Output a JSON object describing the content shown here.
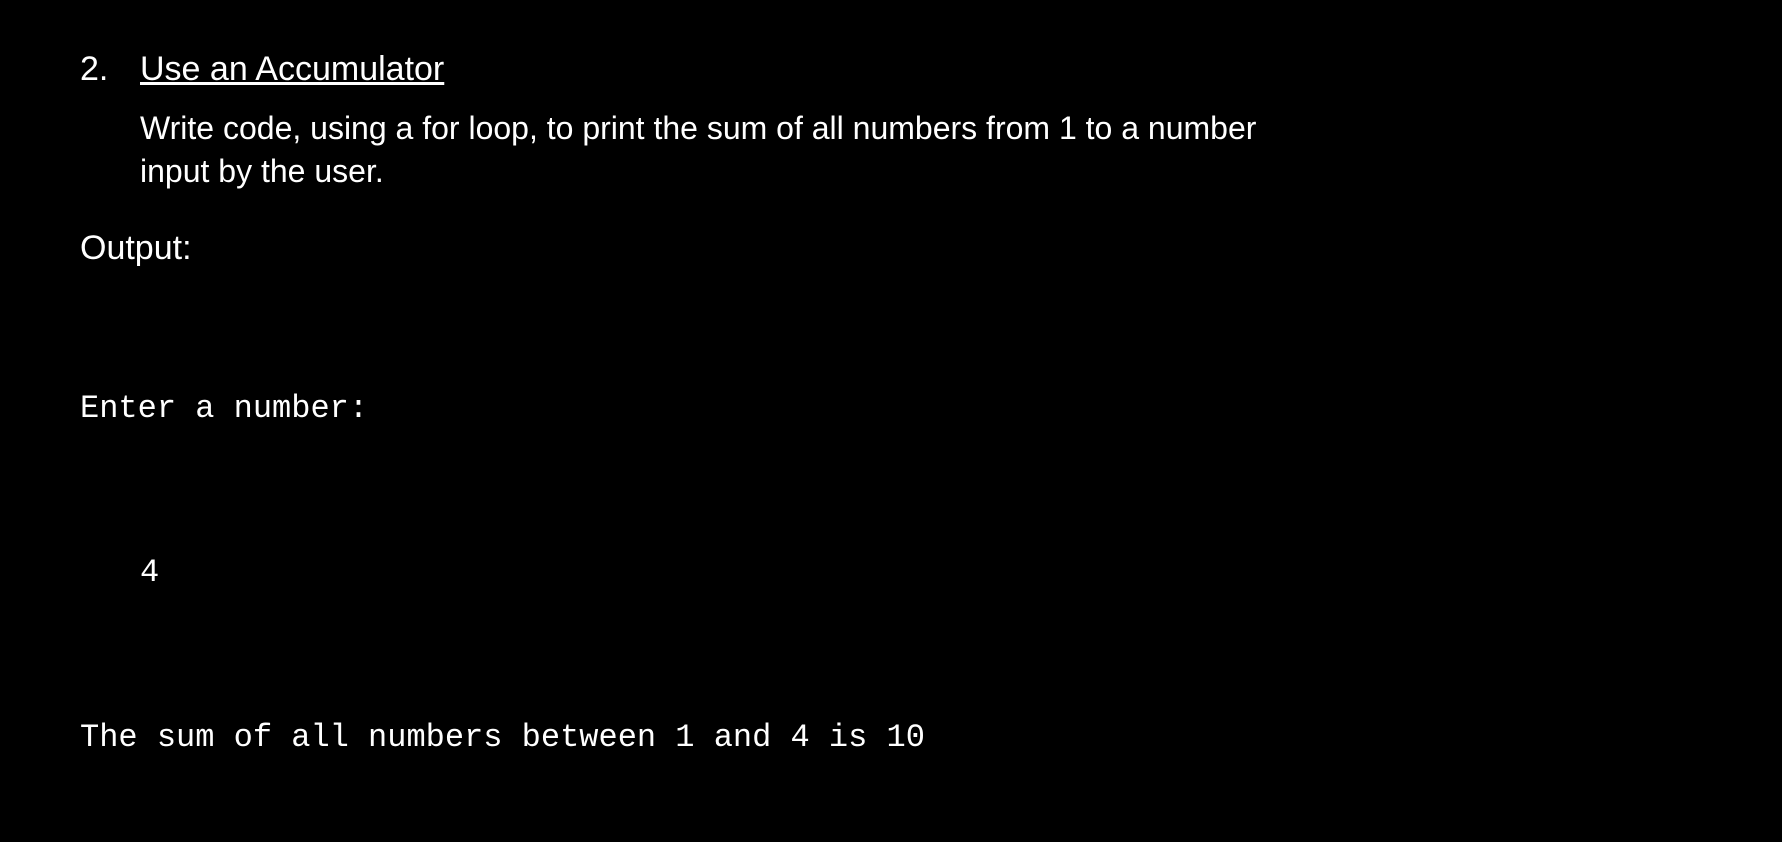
{
  "problem": {
    "number": "2.",
    "title": "Use an Accumulator",
    "description": "Write code, using a for loop, to print the sum of all numbers from 1 to a number input by the user."
  },
  "output": {
    "label": "Output:",
    "lines": {
      "prompt": "Enter a number:",
      "input": "4",
      "result": "The sum of all numbers between 1 and 4 is 10"
    }
  }
}
